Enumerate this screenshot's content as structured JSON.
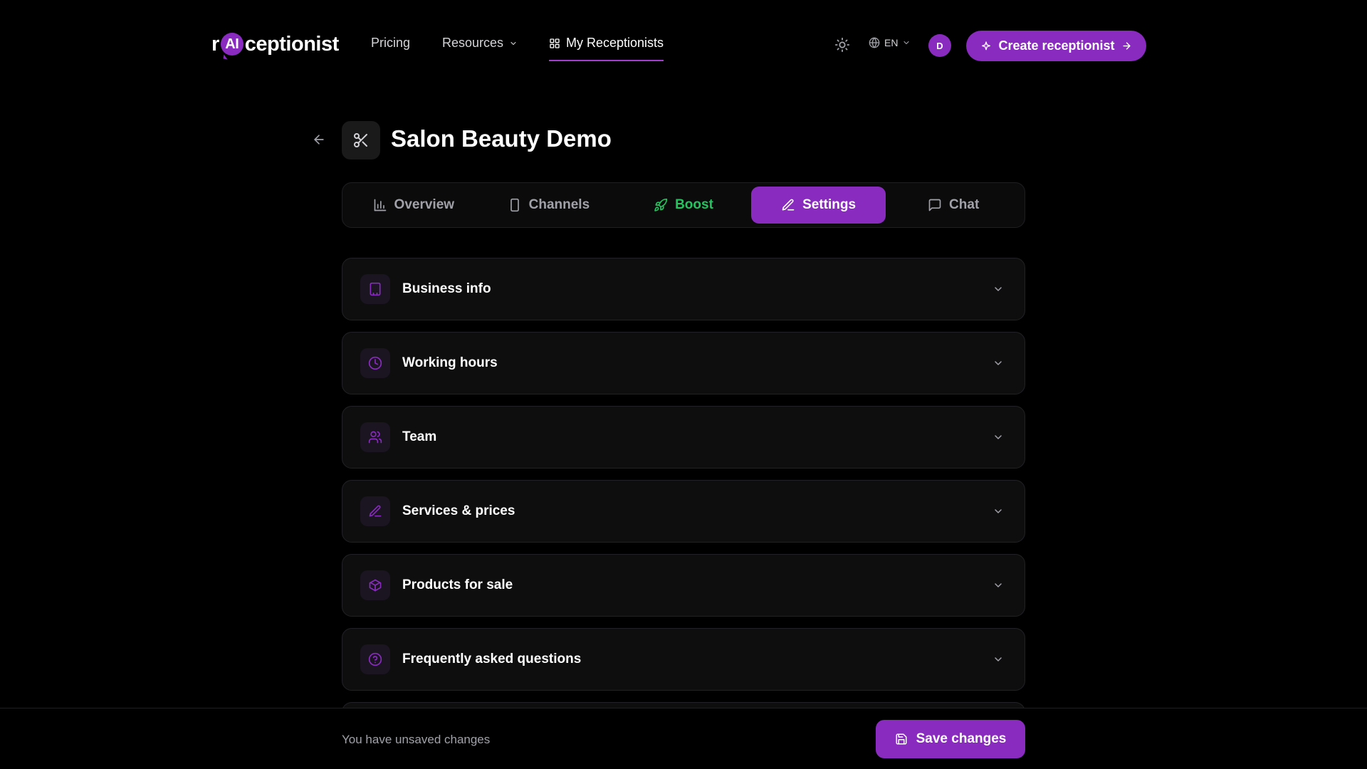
{
  "brand": {
    "logo_prefix": "r",
    "logo_ai": "AI",
    "logo_suffix": "ceptionist",
    "accent": "#8a2bc0",
    "boost_color": "#22c55e"
  },
  "nav": {
    "pricing": "Pricing",
    "resources": "Resources",
    "my_receptionists": "My Receptionists",
    "language": "EN",
    "avatar_initial": "D",
    "create_button": "Create receptionist"
  },
  "page": {
    "title": "Salon Beauty Demo",
    "icon": "scissors-icon"
  },
  "tabs": [
    {
      "label": "Overview",
      "icon": "bar-chart-icon"
    },
    {
      "label": "Channels",
      "icon": "phone-icon"
    },
    {
      "label": "Boost",
      "icon": "rocket-icon"
    },
    {
      "label": "Settings",
      "icon": "pencil-icon",
      "active": true
    },
    {
      "label": "Chat",
      "icon": "message-icon"
    }
  ],
  "sections": [
    {
      "label": "Business info",
      "icon": "building-icon"
    },
    {
      "label": "Working hours",
      "icon": "clock-icon"
    },
    {
      "label": "Team",
      "icon": "users-icon"
    },
    {
      "label": "Services & prices",
      "icon": "pencil-icon"
    },
    {
      "label": "Products for sale",
      "icon": "package-icon"
    },
    {
      "label": "Frequently asked questions",
      "icon": "help-circle-icon"
    }
  ],
  "footer": {
    "unsaved_text": "You have unsaved changes",
    "save_button": "Save changes"
  }
}
